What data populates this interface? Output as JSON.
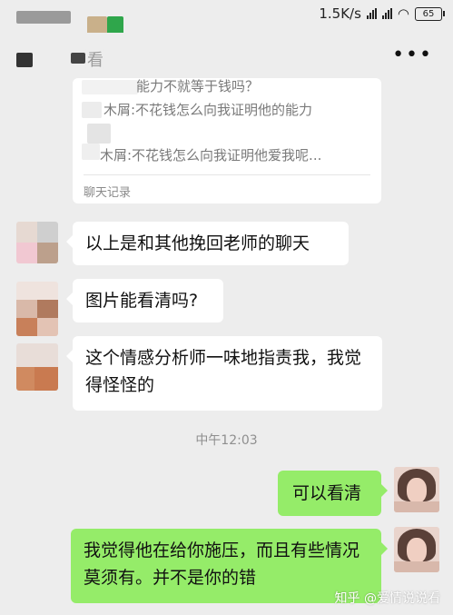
{
  "status_bar": {
    "net_speed": "1.5K/s",
    "battery": "65"
  },
  "chat": {
    "title_partial": "看",
    "forwarded_log": {
      "lines": [
        "能力不就等于钱吗？",
        "木屑:不花钱怎么向我证明他的能力",
        "木屑:不花钱怎么向我证明他爱我呢..."
      ],
      "label": "聊天记录"
    },
    "messages": [
      {
        "side": "in",
        "text": "以上是和其他挽回老师的聊天"
      },
      {
        "side": "in",
        "text": "图片能看清吗?"
      },
      {
        "side": "in",
        "text": "这个情感分析师一味地指责我，我觉得怪怪的"
      },
      {
        "side": "out",
        "text": "可以看清"
      },
      {
        "side": "out",
        "text": "我觉得他在给你施压，而且有些情况莫须有。并不是你的错"
      }
    ],
    "timestamp": "中午12:03"
  },
  "watermark": "知乎 @爱情说说看",
  "colors": {
    "background": "#ededed",
    "bubble_in": "#ffffff",
    "bubble_out": "#95ec69"
  }
}
